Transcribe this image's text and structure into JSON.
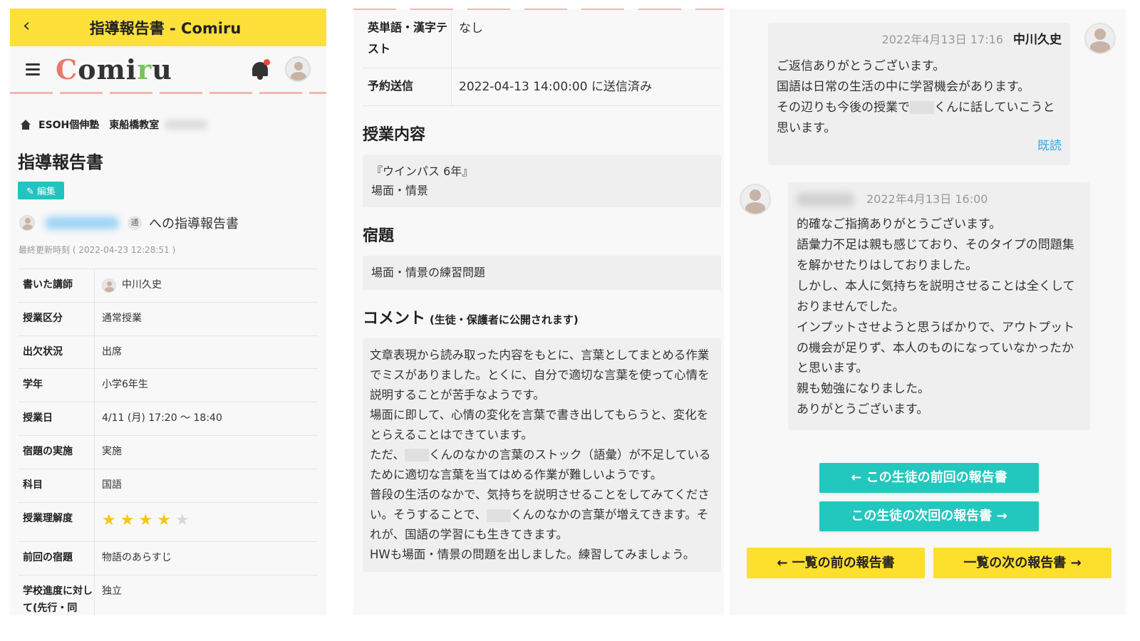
{
  "p1": {
    "header_title": "指導報告書 - Comiru",
    "logo": "Comiru",
    "breadcrumb": {
      "school": "ESOH個伸塾",
      "room": "東船橋教室"
    },
    "page_title": "指導報告書",
    "edit_label": "編集",
    "student_tag": "通",
    "student_suffix": "への指導報告書",
    "updated": "最終更新時刻 ( 2022-04-23 12:28:51 )",
    "rows": [
      {
        "k": "書いた講師",
        "v": "中川久史"
      },
      {
        "k": "授業区分",
        "v": "通常授業"
      },
      {
        "k": "出欠状況",
        "v": "出席"
      },
      {
        "k": "学年",
        "v": "小学6年生"
      },
      {
        "k": "授業日",
        "v": "4/11 (月) 17:20 〜 18:40"
      },
      {
        "k": "宿題の実施",
        "v": "実施"
      },
      {
        "k": "科目",
        "v": "国語"
      },
      {
        "k": "授業理解度",
        "v": ""
      },
      {
        "k": "前回の宿題",
        "v": "物語のあらすじ"
      },
      {
        "k": "学校進度に対して(先行・同じ・遅れ・独立)",
        "v": "独立"
      }
    ],
    "rating": 4,
    "rating_max": 5
  },
  "p2": {
    "rows": [
      {
        "k": "英単語・漢字テスト",
        "v": "なし"
      },
      {
        "k": "予約送信",
        "v": "2022-04-13 14:00:00 に送信済み"
      }
    ],
    "lesson_title": "授業内容",
    "lesson_lines": [
      "『ウインパス 6年』",
      "場面・情景"
    ],
    "hw_title": "宿題",
    "hw_text": "場面・情景の練習問題",
    "comment_title": "コメント",
    "comment_note": "(生徒・保護者に公開されます)",
    "comment": {
      "l1": "文章表現から読み取った内容をもとに、言葉としてまとめる作業でミスがありました。とくに、自分で適切な言葉を使って心情を説明することが苦手なようです。",
      "l2": "場面に即して、心情の変化を言葉で書き出してもらうと、変化をとらえることはできています。",
      "l3a": "ただ、",
      "l3b": "くんのなかの言葉のストック（語彙）が不足しているために適切な言葉を当てはめる作業が難しいようです。",
      "l4a": "普段の生活のなかで、気持ちを説明させることをしてみてください。そうすることで、",
      "l4b": "くんのなかの言葉が増えてきます。それが、国語の学習にも生きてきます。",
      "l5": "HWも場面・情景の問題を出しました。練習してみましょう。"
    }
  },
  "p3": {
    "msg1": {
      "time": "2022年4月13日 17:16",
      "author": "中川久史",
      "l1": "ご返信ありがとうございます。",
      "l2": "国語は日常の生活の中に学習機会があります。",
      "l3a": "その辺りも今後の授業で",
      "l3b": "くんに話していこうと思います。",
      "read": "既読"
    },
    "msg2": {
      "time": "2022年4月13日 16:00",
      "lines": [
        "的確なご指摘ありがとうございます。",
        "語彙力不足は親も感じており、そのタイプの問題集を解かせたりはしておりました。",
        "しかし、本人に気持ちを説明させることは全くしておりませんでした。",
        "インプットさせようと思うばかりで、アウトプットの機会が足りず、本人のものになっていなかったかと思います。",
        "親も勉強になりました。",
        "ありがとうございます。"
      ]
    },
    "buttons": {
      "prev_student": "← この生徒の前回の報告書",
      "next_student": "この生徒の次回の報告書 →",
      "prev_list": "← 一覧の前の報告書",
      "next_list": "一覧の次の報告書 →"
    }
  },
  "colors": {
    "yellow": "#fde03a",
    "teal": "#22c7bd",
    "star": "#f7c614",
    "read": "#3aa6d9"
  }
}
